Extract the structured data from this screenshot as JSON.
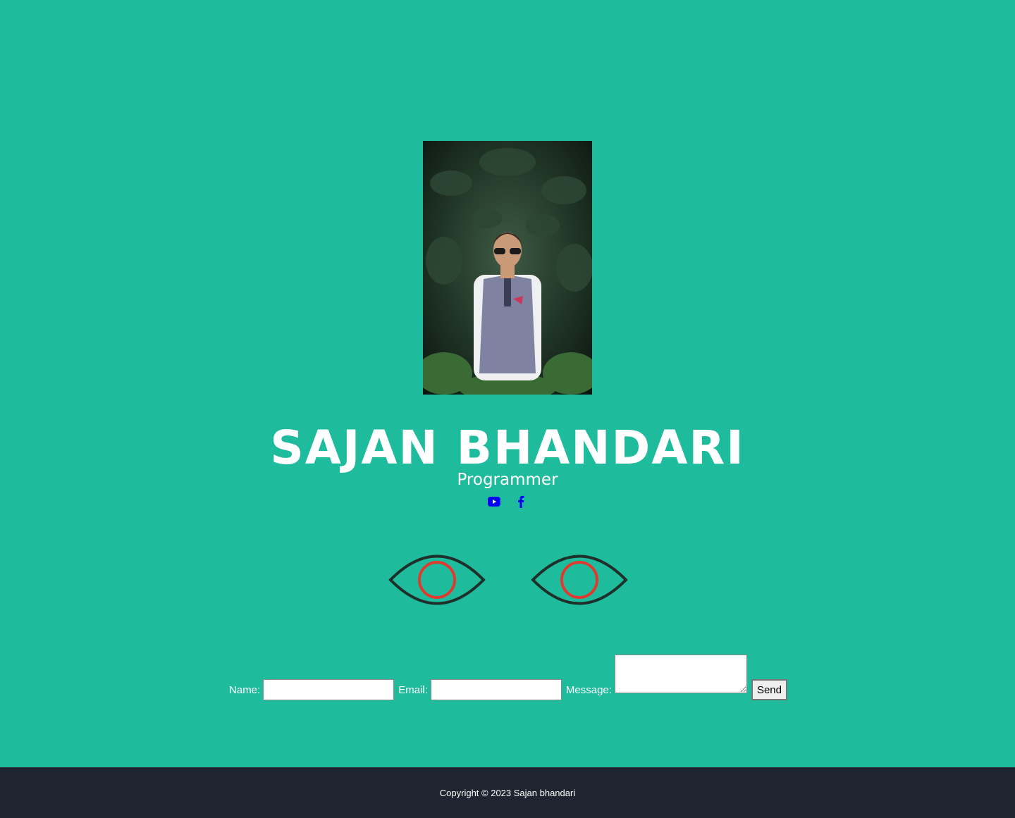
{
  "profile": {
    "photo_alt": "Sajan Bhandari portrait",
    "name": "SAJAN BHANDARI",
    "role": "Programmer"
  },
  "social": [
    {
      "icon": "youtube-icon",
      "color": "#0000ff"
    },
    {
      "icon": "facebook-icon",
      "color": "#0000ff"
    }
  ],
  "eyes": {
    "outline_color": "#1f2f2a",
    "iris_color": "#e03a2e"
  },
  "contact_form": {
    "name_label": "Name:",
    "name_value": "",
    "email_label": "Email:",
    "email_value": "",
    "message_label": "Message:",
    "message_value": "",
    "send_label": "Send"
  },
  "footer": {
    "copyright": "Copyright © 2023 Sajan bhandari"
  },
  "colors": {
    "background": "#1ebc9c",
    "footer_background": "#1e2430",
    "text": "#ffffff"
  }
}
